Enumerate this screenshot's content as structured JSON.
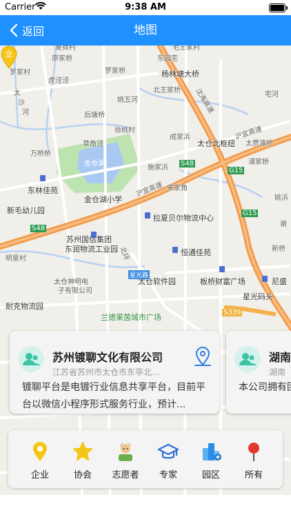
{
  "status_bar": {
    "carrier": "Carrier",
    "time": "9:38 AM"
  },
  "nav": {
    "back_label": "返回",
    "title": "地图"
  },
  "map": {
    "labels": {
      "l1": "夏荷村",
      "l2": "罗家桥",
      "l3": "罗家村",
      "l4": "虎泾泾",
      "l5": "太",
      "l6": "沙",
      "l7": "河",
      "l8": "后塘桥",
      "l9": "草角泾",
      "l10": "万桥桥",
      "l11": "金仓湖",
      "l12": "东林佳苑",
      "l13": "新毛幼儿园",
      "l14": "金仓湖小学",
      "l15": "S48",
      "l16": "苏州国信集团",
      "l17": "东润物流工业园",
      "l18": "明星村",
      "l19": "太仓神明电",
      "l20": "子有限公司",
      "l21": "耐克物流园",
      "l22": "兰德莱茵城市广场",
      "l23": "杨林塘大桥",
      "l24": "北王家桥",
      "l25": "姚五河",
      "l26": "徐桃村",
      "l27": "成家浜",
      "l28": "施家浜",
      "l29": "太仓北枢纽",
      "l30": "宋家角",
      "l31": "拉夏贝尔物流中心",
      "l32": "恒通佳苑",
      "l33": "板桥财富广场",
      "l34": "太仓软件园",
      "l35": "星光码头",
      "l36": "S339",
      "l37": "G15",
      "l38": "浦家桥",
      "l39": "沪宜高速",
      "l40": "沈海高速",
      "l41": "尼盛",
      "l42": "新桥",
      "l43": "宅河",
      "l44": "太费渡桥",
      "l45": "S48",
      "l46": "浦家桥",
      "l47": "毛王家村",
      "l48": "东园宅",
      "l49": "原家桥",
      "l50": "姚浜",
      "l51": "谢",
      "l52": "北",
      "l53": "G15",
      "l54": "沪宜高速",
      "l55": "北环",
      "l56": "星光路"
    }
  },
  "cards": [
    {
      "name": "苏州镀聊文化有限公司",
      "address": "江苏省苏州市太仓市东亭北...",
      "description": "镀聊平台是电镀行业信息共享平台，目前平台以微信小程序形式服务行业，预计..."
    },
    {
      "name": "湖南",
      "address": "湖南",
      "description": "本公司拥有团队与中i"
    }
  ],
  "categories": [
    {
      "label": "企业",
      "icon": "location-pin-icon",
      "color": "#f5c518"
    },
    {
      "label": "协会",
      "icon": "star-icon",
      "color": "#f5c518"
    },
    {
      "label": "志愿者",
      "icon": "volunteer-icon",
      "color": "#f2a33a"
    },
    {
      "label": "专家",
      "icon": "graduation-cap-icon",
      "color": "#2b6fd6"
    },
    {
      "label": "园区",
      "icon": "buildings-icon",
      "color": "#2b8ce8"
    },
    {
      "label": "所有",
      "icon": "map-pin-icon",
      "color": "#e03a2f"
    }
  ],
  "colors": {
    "nav": "#1e90ff",
    "highway": "#f39c4b",
    "water": "#a9c9f3",
    "park": "#bde3b0"
  }
}
